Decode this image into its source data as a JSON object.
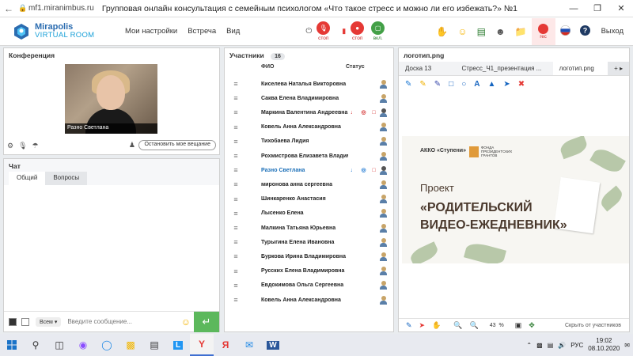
{
  "browser": {
    "url": "mf1.miranimbus.ru",
    "title": "Групповая онлайн консультация с семейным психологом «Что такое стресс и можно ли его избежать?» №1"
  },
  "app": {
    "logo_line1": "Mirapolis",
    "logo_line2": "VIRTUAL ROOM",
    "menu": [
      "Мои настройки",
      "Встреча",
      "Вид"
    ],
    "controls": [
      {
        "label": "стоп",
        "color": "#e53935"
      },
      {
        "label": "стоп",
        "color": "#e53935"
      },
      {
        "label": "вкл.",
        "color": "#43a047"
      }
    ],
    "rec_label": "rec",
    "exit_label": "Выход"
  },
  "conference": {
    "title": "Конференция",
    "video_name": "Разно Светлана",
    "stop_button": "Остановить мое вещание"
  },
  "chat": {
    "title": "Чат",
    "tabs": [
      "Общий",
      "Вопросы"
    ],
    "to_select": "Всем",
    "input_placeholder": "Введите сообщение..."
  },
  "participants": {
    "title": "Участники",
    "count": "16",
    "col_name": "ФИО",
    "col_status": "Статус",
    "rows": [
      {
        "name": "Киселева  Наталья  Викторовна",
        "status": []
      },
      {
        "name": "Саква Елена Владимировна",
        "status": []
      },
      {
        "name": "Маркина Валентина  Андреевна",
        "status": [
          "red",
          "red",
          "red"
        ]
      },
      {
        "name": "Ковель Анна Александровна",
        "status": []
      },
      {
        "name": "Тихобаева Лидия",
        "status": []
      },
      {
        "name": "Рохмистрова  Елизавета  Владимировна",
        "status": []
      },
      {
        "name": "Разно Светлана",
        "status": [
          "blue",
          "blue",
          "red"
        ],
        "highlight": true
      },
      {
        "name": "миронова  анна  сергеевна",
        "status": []
      },
      {
        "name": "Шинкаренко  Анастасия",
        "status": []
      },
      {
        "name": "Лысенко Елена",
        "status": []
      },
      {
        "name": "Малкина Татьяна  Юрьевна",
        "status": []
      },
      {
        "name": "Турыгина  Елена  Ивановна",
        "status": []
      },
      {
        "name": "Буркова  Ирина Владимировна",
        "status": []
      },
      {
        "name": "Русских Елена Владимировна",
        "status": []
      },
      {
        "name": "Евдокимова Ольга  Сергеевна",
        "status": []
      },
      {
        "name": "Ковель  Анна Александровна",
        "status": []
      }
    ]
  },
  "presentation": {
    "title": "логотип.png",
    "tabs": [
      "Доска 13",
      "Стресс_Ч1_презентация ...",
      "логотип.png",
      "+ ▸"
    ],
    "slide": {
      "org": "АККО «Ступени»",
      "fund_line": "ФОНДА ПРЕЗИДЕНТСКИХ ГРАНТОВ",
      "heading": "Проект",
      "title": "«РОДИТЕЛЬСКИЙ ВИДЕО-ЕЖЕДНЕВНИК»"
    },
    "zoom": "43",
    "zoom_unit": "%",
    "hide_label": "Скрыть от участников"
  },
  "taskbar": {
    "lang": "РУС",
    "time": "19:02",
    "date": "08.10.2020"
  }
}
